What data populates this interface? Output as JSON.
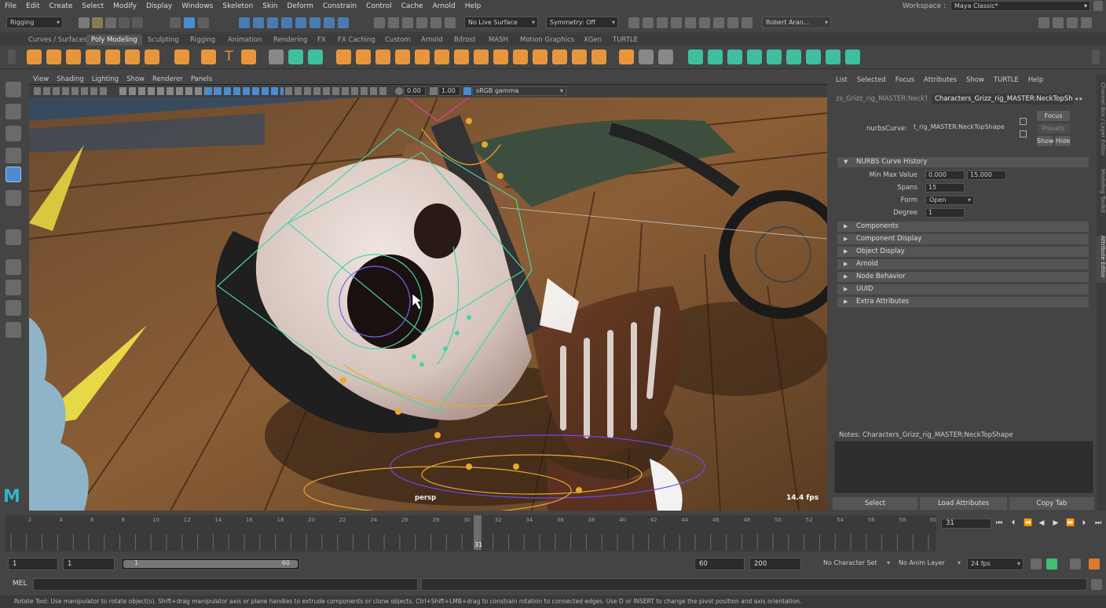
{
  "menubar": {
    "items": [
      "File",
      "Edit",
      "Create",
      "Select",
      "Modify",
      "Display",
      "Windows",
      "Skeleton",
      "Skin",
      "Deform",
      "Constrain",
      "Control",
      "Cache",
      "Arnold",
      "Help"
    ],
    "workspace_label": "Workspace :",
    "workspace_value": "Maya Classic*"
  },
  "statusline": {
    "mode": "Rigging",
    "live_surface": "No Live Surface",
    "symmetry": "Symmetry: Off",
    "user": "Robert Aran..."
  },
  "shelf": {
    "tabs": [
      "Curves / Surfaces",
      "Poly Modeling",
      "Sculpting",
      "Rigging",
      "Animation",
      "Rendering",
      "FX",
      "FX Caching",
      "Custom",
      "Arnold",
      "Bifrost",
      "MASH",
      "Motion Graphics",
      "XGen",
      "TURTLE"
    ],
    "active_tab": "Poly Modeling"
  },
  "viewport": {
    "menu": [
      "View",
      "Shading",
      "Lighting",
      "Show",
      "Renderer",
      "Panels"
    ],
    "exposure": "0.00",
    "gamma": "1.00",
    "colorspace": "sRGB gamma",
    "camera": "persp",
    "fps": "14.4 fps"
  },
  "attribute_editor": {
    "menu": [
      "List",
      "Selected",
      "Focus",
      "Attributes",
      "Show",
      "TURTLE",
      "Help"
    ],
    "tabs": [
      "zs_Grizz_rig_MASTER:NeckTop",
      "Characters_Grizz_rig_MASTER:NeckTopShape"
    ],
    "node_type_label": "nurbsCurve:",
    "node_name": "t_rig_MASTER:NeckTopShape",
    "buttons": {
      "focus": "Focus",
      "presets": "Presets",
      "show": "Show",
      "hide": "Hide"
    },
    "history_section": "NURBS Curve History",
    "fields": {
      "min_max_label": "Min Max Value",
      "min_value": "0.000",
      "max_value": "15.000",
      "spans_label": "Spans",
      "spans": "15",
      "form_label": "Form",
      "form": "Open",
      "degree_label": "Degree",
      "degree": "1"
    },
    "sections": [
      "Components",
      "Component Display",
      "Object Display",
      "Arnold",
      "Node Behavior",
      "UUID",
      "Extra Attributes"
    ],
    "notes_label": "Notes:  Characters_Grizz_rig_MASTER:NeckTopShape",
    "bottom_buttons": [
      "Select",
      "Load Attributes",
      "Copy Tab"
    ]
  },
  "side_tabs": [
    "Channel Box / Layer Editor",
    "Modeling Toolkit",
    "Attribute Editor"
  ],
  "timeslider": {
    "ticks": [
      "2",
      "4",
      "6",
      "8",
      "10",
      "12",
      "14",
      "16",
      "18",
      "20",
      "22",
      "24",
      "26",
      "28",
      "30",
      "32",
      "34",
      "36",
      "38",
      "40",
      "42",
      "44",
      "46",
      "48",
      "50",
      "52",
      "54",
      "56",
      "58",
      "60"
    ],
    "current_frame": "31",
    "current_frame_field": "31"
  },
  "rangeslider": {
    "start": "1",
    "playback_start": "1",
    "slider_start": "1",
    "slider_end": "60",
    "playback_end": "60",
    "end": "200",
    "character_set": "No Character Set",
    "anim_layer": "No Anim Layer",
    "fps": "24 fps"
  },
  "cmdline": {
    "label": "MEL"
  },
  "helpline": "Rotate Tool: Use manipulator to rotate object(s). Shift+drag manipulator axis or plane handles to extrude components or clone objects. Ctrl+Shift+LMB+drag to constrain rotation to connected edges. Use D or INSERT to change the pivot position and axis orientation.",
  "logo": "M",
  "colors": {
    "accent_blue": "#4a8ccf",
    "shelf_orange": "#e8963c",
    "shelf_green": "#3fbf9f",
    "key_red": "#d9252e"
  }
}
